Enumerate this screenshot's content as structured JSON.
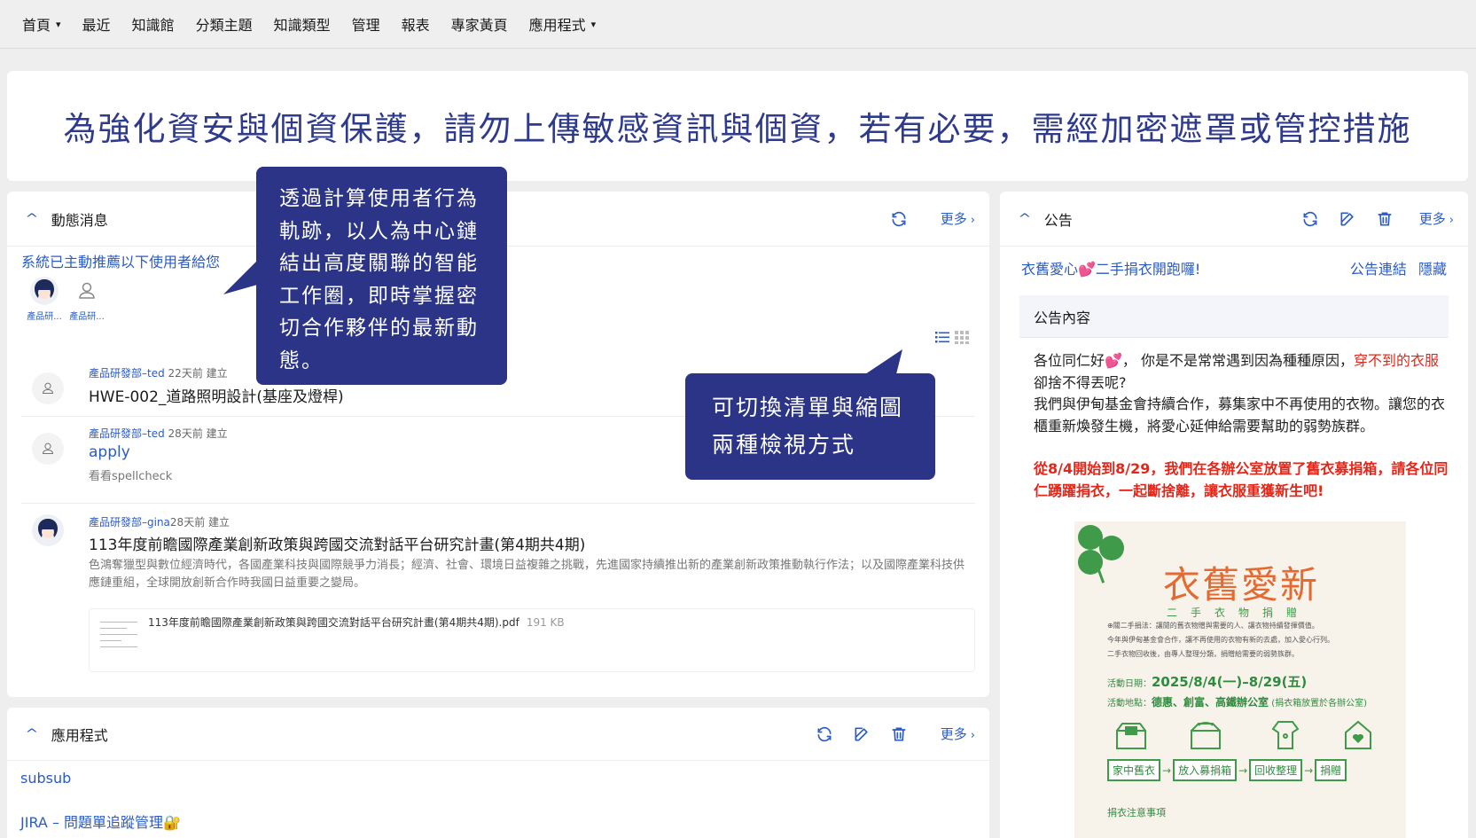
{
  "nav": {
    "items": [
      "首頁",
      "最近",
      "知識館",
      "分類主題",
      "知識類型",
      "管理",
      "報表",
      "專家黃頁",
      "應用程式"
    ]
  },
  "banner": {
    "text": "為強化資安與個資保護，請勿上傳敏感資訊與個資，若有必要，需經加密遮罩或管控措施"
  },
  "activity": {
    "title": "動態消息",
    "more": "更多",
    "recommend_text": "系統已主動推薦以下使用者給您",
    "recommended_users": [
      {
        "name": "產品研..."
      },
      {
        "name": "產品研..."
      }
    ],
    "items": [
      {
        "author": "產品研發部–ted",
        "time": "22天前 建立",
        "title": "HWE-002_道路照明設計(基座及燈桿)"
      },
      {
        "author": "產品研發部–ted",
        "time": "28天前 建立",
        "title": "apply",
        "desc": "看看spellcheck"
      },
      {
        "author": "產品研發部–gina",
        "time": "28天前 建立",
        "title": "113年度前瞻國際產業創新政策與跨國交流對話平台研究計畫(第4期共4期)",
        "desc": "色鴻奪獵型與數位經濟時代，各國產業科技與國際競爭力消長；經濟、社會、環境日益複雜之挑戰，先進國家持續推出新的產業創新政策推動執行作法；以及國際產業科技供應鏈重組，全球開放創新合作時我國日益重要之變局。",
        "attachment": {
          "name": "113年度前瞻國際產業創新政策與跨國交流對話平台研究計畫(第4期共4期).pdf",
          "size": "191 KB"
        }
      }
    ]
  },
  "apps": {
    "title": "應用程式",
    "more": "更多",
    "links": [
      "subsub",
      "JIRA – 問題單追蹤管理🔐"
    ]
  },
  "announce": {
    "title": "公告",
    "more": "更多",
    "post_title": "衣舊愛心💕二手捐衣開跑囉!",
    "link_label": "公告連結",
    "hide_label": "隱藏",
    "content_head": "公告內容",
    "p1_a": "各位同仁好💕， 你是不是常常遇到因為種種原因，",
    "p1_red": "穿不到的衣服",
    "p1_b": "卻捨不得丟呢?",
    "p2": "我們與伊甸基金會持續合作，募集家中不再使用的衣物。讓您的衣櫃重新煥發生機，將愛心延伸給需要幫助的弱勢族群。",
    "p3": "從8/4開始到8/29，我們在各辦公室放置了舊衣募捐箱，請各位同仁踴躍捐衣，一起斷捨離，讓衣服重獲新生吧!",
    "poster": {
      "title": "衣舊愛新",
      "subtitle": "二手衣物捐贈",
      "line1": "⊕關二手捐法：讓閒的舊衣物贈與需要的人、讓衣物持續發揮價值。",
      "line2": "今年與伊甸基金會合作，讓不再使用的衣物有新的去處，加入愛心行列。",
      "line3": "二手衣物回收後，由專人整理分類，捐贈給需要的弱勢族群。",
      "date_label": "活動日期：",
      "date": "2025/8/4(一)–8/29(五)",
      "loc_label": "活動地點：",
      "loc": "德惠、創富、高鐵辦公室",
      "loc_note": "(捐衣箱放置於各辦公室)",
      "steps": [
        "家中舊衣",
        "放入募捐箱",
        "回收整理",
        "捐贈"
      ],
      "notice": "捐衣注意事項"
    }
  },
  "callouts": {
    "c1": "透過計算使用者行為軌跡，以人為中心鏈結出高度關聯的智能工作圈，即時掌握密切合作夥伴的最新動態。",
    "c2": "可切換清單與縮圖兩種檢視方式"
  },
  "colors": {
    "accent": "#2a5bc6",
    "callout": "#2b3486",
    "banner_text": "#2e3a8c",
    "warning_red": "#e52618",
    "poster_green": "#3f9a4a",
    "poster_orange": "#e46a32"
  }
}
